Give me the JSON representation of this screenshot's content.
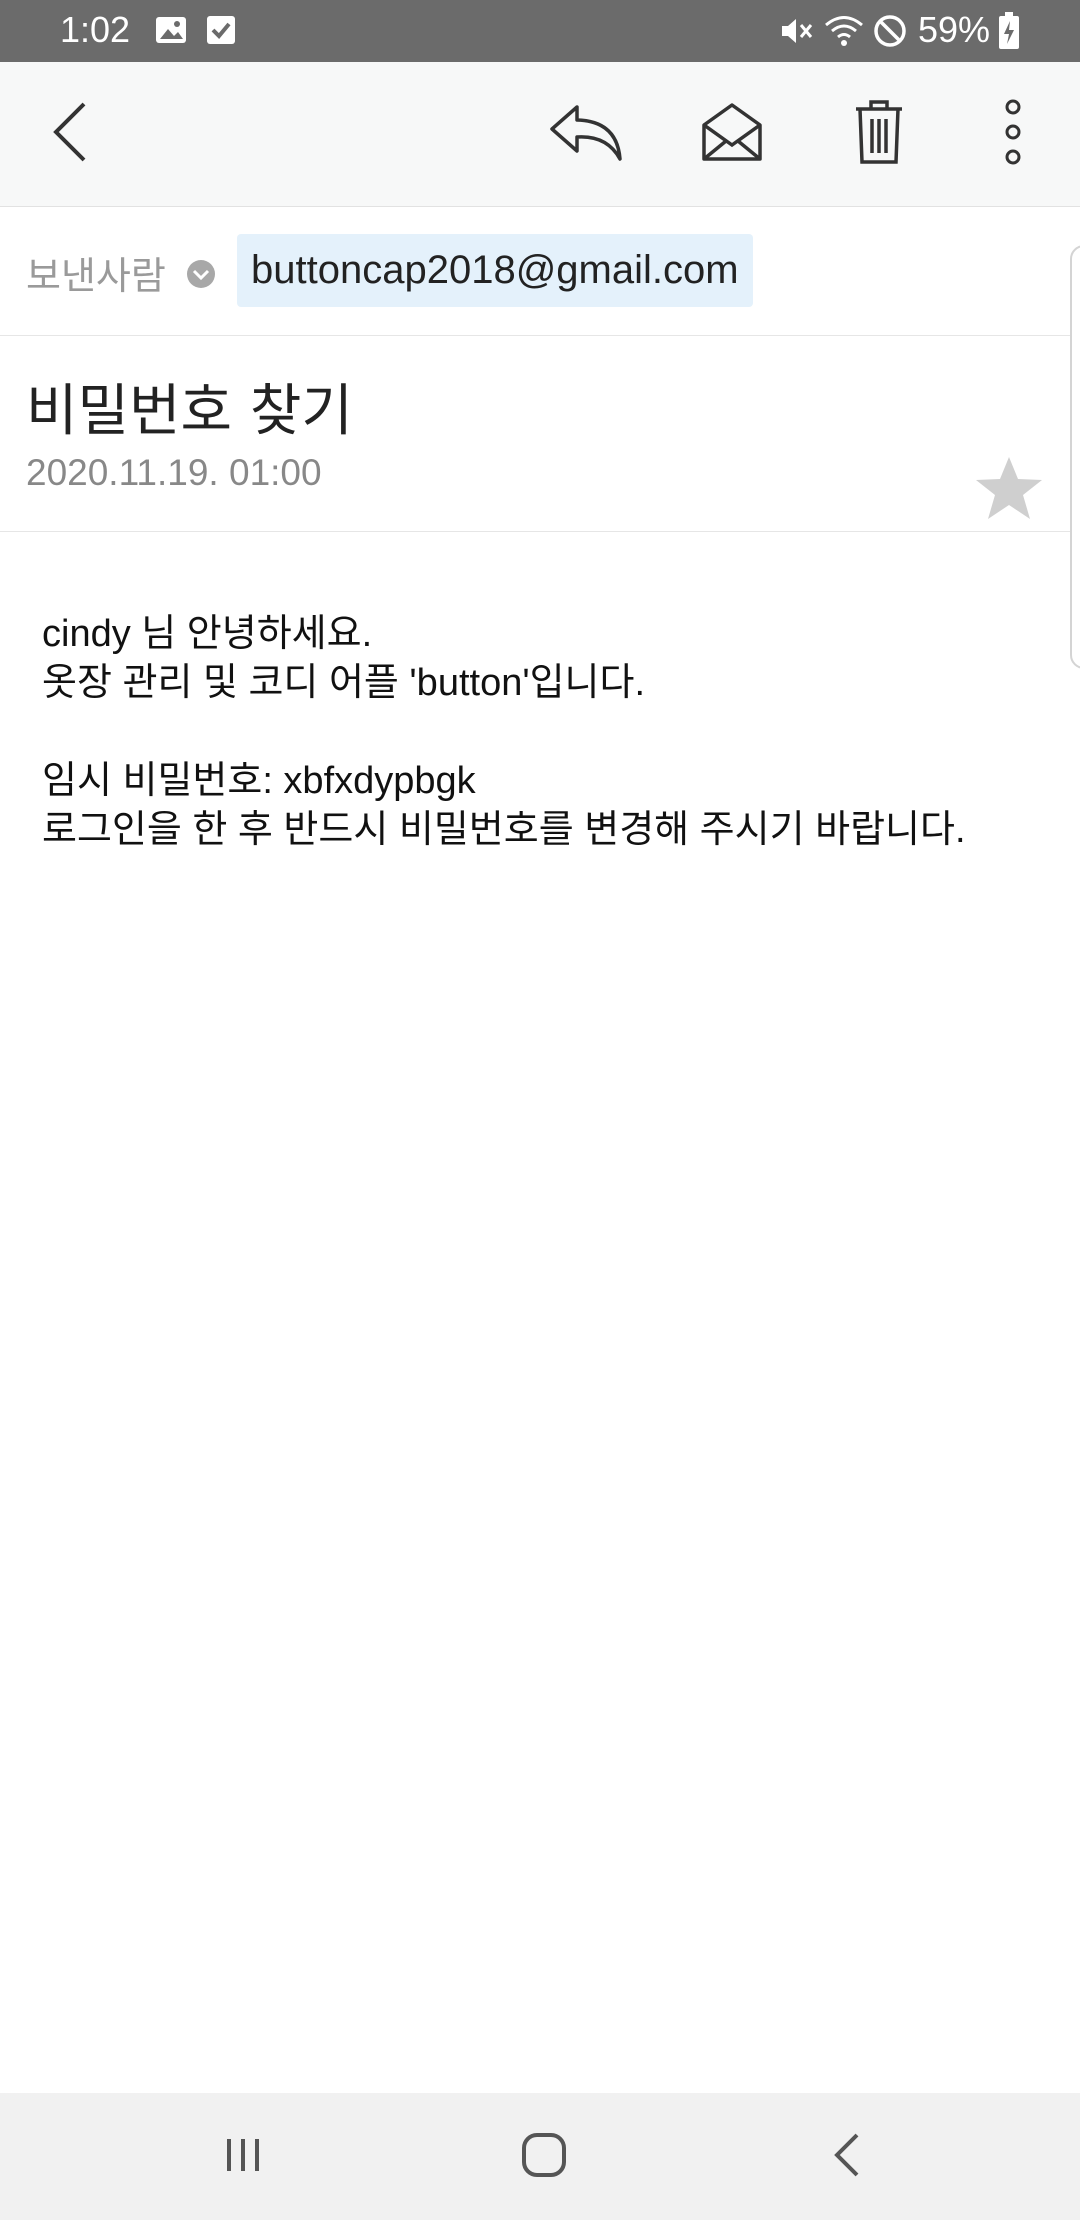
{
  "status_bar": {
    "time": "1:02",
    "battery": "59%",
    "icons": [
      "image-icon",
      "check-box-icon",
      "mute-icon",
      "wifi-icon",
      "do-not-disturb-icon",
      "battery-charging-icon"
    ]
  },
  "toolbar": {
    "icons": [
      "back-icon",
      "reply-icon",
      "mark-unread-icon",
      "trash-icon",
      "more-icon"
    ]
  },
  "email": {
    "sender_label": "보낸사람",
    "sender_address": "buttoncap2018@gmail.com",
    "subject": "비밀번호 찾기",
    "date": "2020.11.19. 01:00",
    "body_lines": [
      "cindy 님 안녕하세요.",
      "옷장 관리 및 코디 어플 'button'입니다.",
      "",
      "임시 비밀번호: xbfxdypbgk",
      "로그인을 한 후 반드시 비밀번호를 변경해 주시기 바랍니다."
    ]
  },
  "nav_bar": {
    "icons": [
      "recent-apps-icon",
      "home-icon",
      "nav-back-icon"
    ]
  },
  "colors": {
    "status_bar_bg": "#6b6b6b",
    "toolbar_bg": "#f7f8f8",
    "sender_chip_bg": "#e4f1fb",
    "nav_bar_bg": "#f1f1f1"
  }
}
